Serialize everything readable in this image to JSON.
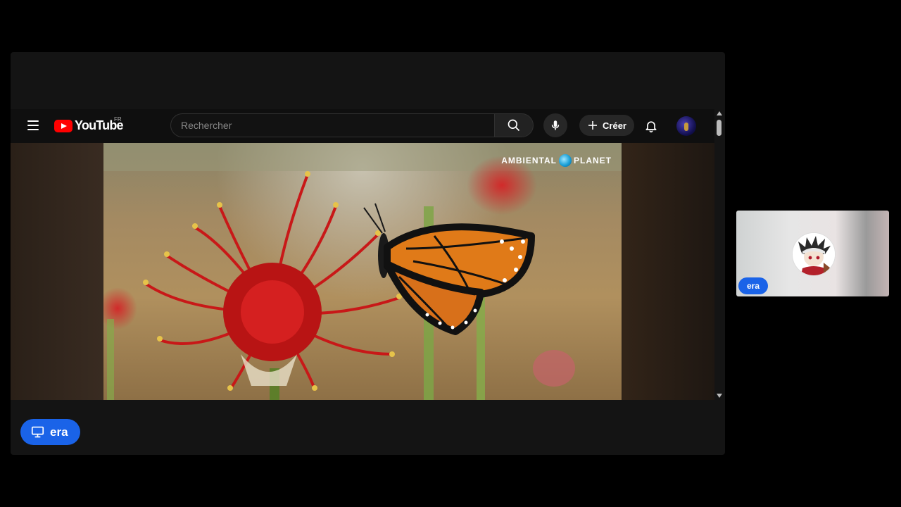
{
  "youtube": {
    "logo_text": "YouTube",
    "country_code": "FR",
    "search": {
      "placeholder": "Rechercher"
    },
    "create_label": "Créer",
    "icons": [
      "menu-icon",
      "search-icon",
      "mic-icon",
      "plus-icon",
      "bell-icon"
    ]
  },
  "video": {
    "watermark_left": "AMBIENTAL",
    "watermark_right": "PLANET"
  },
  "presenter": {
    "label": "era",
    "icon": "screen-share-icon"
  },
  "participant": {
    "name": "era"
  },
  "colors": {
    "accent": "#1a63e8",
    "youtube_red": "#ff0000",
    "background": "#000000"
  }
}
